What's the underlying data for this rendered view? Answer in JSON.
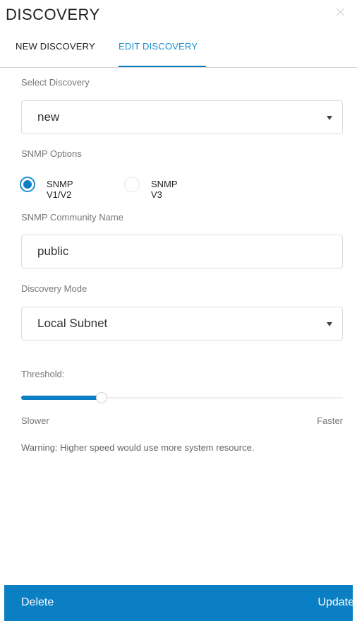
{
  "header": {
    "title": "DISCOVERY"
  },
  "tabs": [
    {
      "label": "NEW DISCOVERY",
      "active": false
    },
    {
      "label": "EDIT DISCOVERY",
      "active": true
    }
  ],
  "form": {
    "select_discovery": {
      "label": "Select Discovery",
      "value": "new"
    },
    "snmp_options": {
      "label": "SNMP Options",
      "options": [
        {
          "label": "SNMP V1/V2",
          "selected": true
        },
        {
          "label": "SNMP V3",
          "selected": false
        }
      ]
    },
    "community_name": {
      "label": "SNMP Community Name",
      "value": "public"
    },
    "discovery_mode": {
      "label": "Discovery Mode",
      "value": "Local Subnet"
    },
    "threshold": {
      "label": "Threshold:",
      "level_fraction": 0.25,
      "min_label": "Slower",
      "max_label": "Faster"
    },
    "warning": "Warning: Higher speed would use more system resource."
  },
  "footer": {
    "delete_label": "Delete",
    "update_label": "Update"
  },
  "colors": {
    "accent": "#0b7fc3",
    "tab_active_text": "#1a8fd1"
  },
  "icons": {
    "close": "close-icon",
    "dropdown": "chevron-down-icon"
  }
}
